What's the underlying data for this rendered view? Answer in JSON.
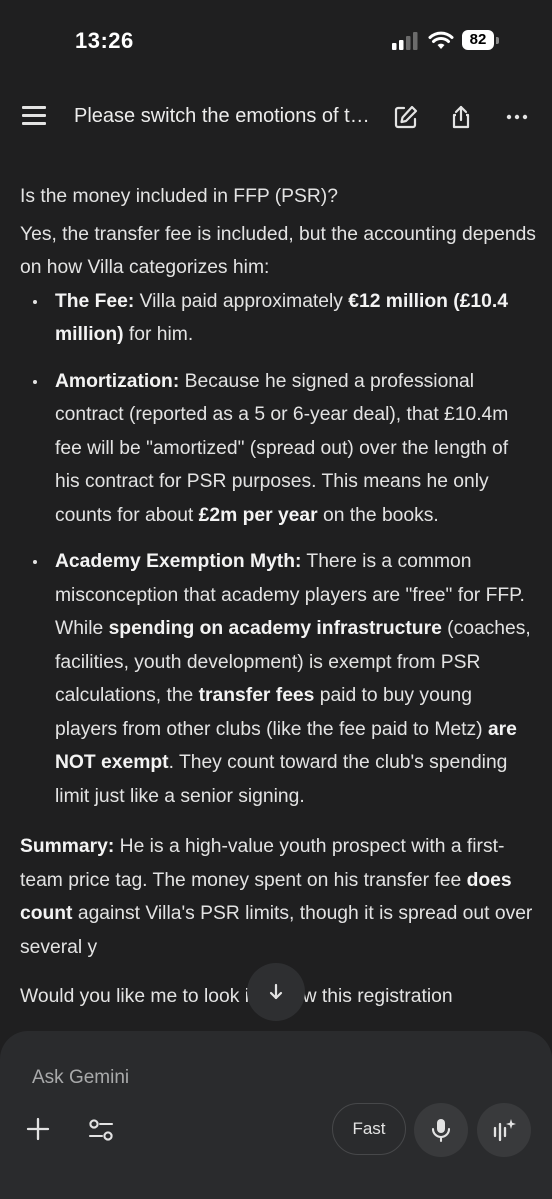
{
  "status_bar": {
    "time": "13:26",
    "battery": "82"
  },
  "top_bar": {
    "title": "Please switch the emotions of the..."
  },
  "response": {
    "heading": "Is the money included in FFP (PSR)?",
    "intro": "Yes, the transfer fee is included, but the accounting depends on how Villa categorizes him:",
    "fee": {
      "label": "The Fee:",
      "t1": " Villa paid approximately ",
      "b1": "€12 million (£10.4 million)",
      "t2": " for him."
    },
    "amortization": {
      "label": "Amortization:",
      "t1": " Because he signed a professional contract (reported as a 5 or 6-year deal), that £10.4m fee will be \"amortized\" (spread out) over the length of his contract for PSR purposes. This means he only counts for about ",
      "b1": "£2m per year",
      "t2": " on the books."
    },
    "academy": {
      "label": "Academy Exemption Myth:",
      "t1": " There is a common misconception that academy players are \"free\" for FFP. While ",
      "b1": "spending on academy infrastructure",
      "t2": " (coaches, facilities, youth development) is exempt from PSR calculations, the ",
      "b2": "transfer fees",
      "t3": " paid to buy young players from other clubs (like the fee paid to Metz) ",
      "b3": "are NOT exempt",
      "t4": ". They count toward the club's spending limit just like a senior signing."
    },
    "summary": {
      "label": "Summary:",
      "t1": " He is a high-value youth prospect with a first-team price tag. The money spent on his transfer fee ",
      "b1": "does count",
      "t2": " against Villa's PSR limits, though it is spread out over several y"
    },
    "trailing": "Would you like me to look into how this registration"
  },
  "composer": {
    "placeholder": "Ask Gemini",
    "mode_label": "Fast"
  },
  "icons": {
    "menu": "hamburger-menu-icon",
    "edit": "edit-pencil-icon",
    "share": "share-icon",
    "more": "more-horizontal-icon",
    "scroll": "arrow-down-icon",
    "plus": "plus-icon",
    "tools": "tools-sliders-icon",
    "mic": "microphone-icon",
    "live": "gemini-live-sparkle-icon"
  },
  "colors": {
    "background": "#1f1f20",
    "panel": "#2a2b2d",
    "text": "#e3e3e3"
  }
}
